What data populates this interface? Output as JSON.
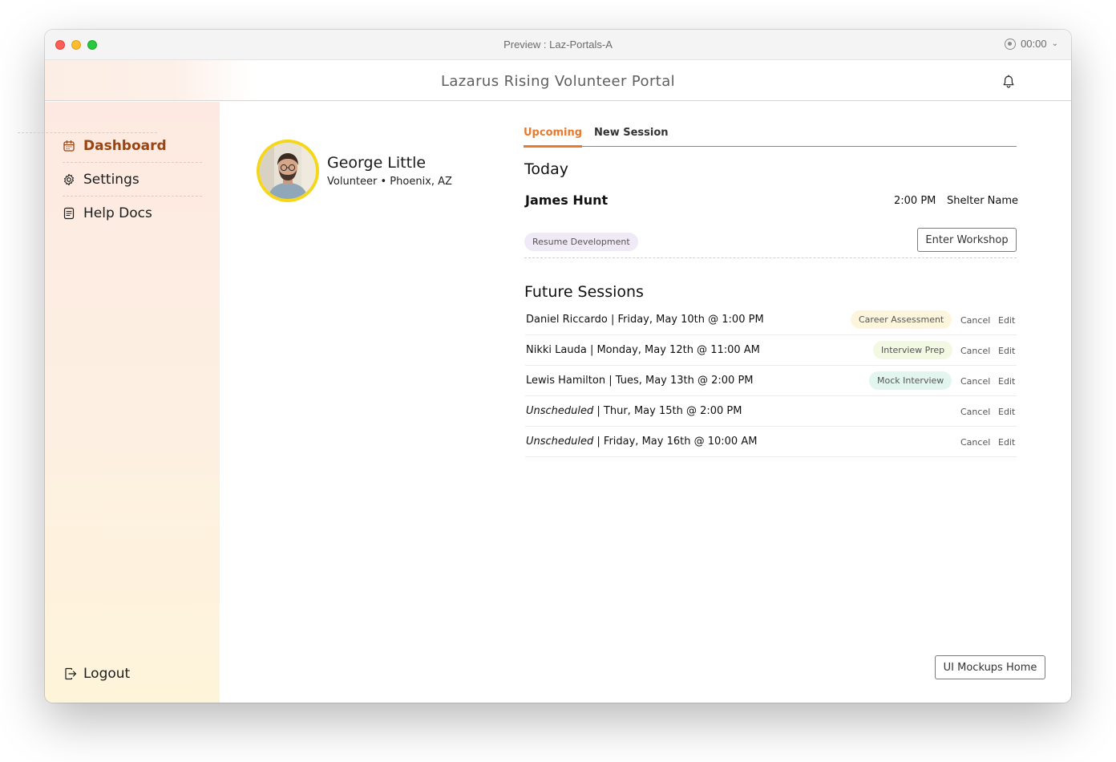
{
  "window": {
    "title": "Preview : Laz-Portals-A",
    "timer": "00:00"
  },
  "header": {
    "title": "Lazarus Rising Volunteer Portal",
    "icon": "bell-icon"
  },
  "sidebar": {
    "items": [
      {
        "label": "Dashboard",
        "icon": "calendar-icon",
        "active": true
      },
      {
        "label": "Settings",
        "icon": "gear-icon",
        "active": false
      },
      {
        "label": "Help Docs",
        "icon": "document-icon",
        "active": false
      }
    ],
    "logout_label": "Logout"
  },
  "profile": {
    "name": "George Little",
    "subtitle": "Volunteer • Phoenix, AZ",
    "avatar_border": "#f4d71b"
  },
  "tabs": [
    {
      "label": "Upcoming",
      "active": true
    },
    {
      "label": "New Session",
      "active": false
    }
  ],
  "today": {
    "heading": "Today",
    "name": "James Hunt",
    "time": "2:00 PM",
    "location": "Shelter Name",
    "tag": "Resume Development",
    "button_label": "Enter Workshop"
  },
  "future": {
    "heading": "Future Sessions",
    "cancel_label": "Cancel",
    "edit_label": "Edit",
    "rows": [
      {
        "name": "Daniel Riccardo",
        "when": " | Friday, May 10th @ 1:00 PM",
        "tag": "Career Assessment",
        "tag_color": "#fdf6dc"
      },
      {
        "name": "Nikki Lauda",
        "when": " | Monday, May 12th @ 11:00 AM",
        "tag": "Interview Prep",
        "tag_color": "#f3f8e3"
      },
      {
        "name": "Lewis Hamilton",
        "when": " | Tues, May 13th @ 2:00 PM",
        "tag": "Mock Interview",
        "tag_color": "#e2f5ef"
      },
      {
        "name": "Unscheduled",
        "when": " | Thur, May 15th @ 2:00 PM",
        "tag": "",
        "tag_color": ""
      },
      {
        "name": "Unscheduled",
        "when": " | Friday, May 16th @ 10:00 AM",
        "tag": "",
        "tag_color": ""
      }
    ]
  },
  "footer": {
    "mockups_label": "UI Mockups Home"
  },
  "colors": {
    "accent": "#e67a2e",
    "active_nav": "#9a4412",
    "tag_resume": "#efeaf6"
  }
}
